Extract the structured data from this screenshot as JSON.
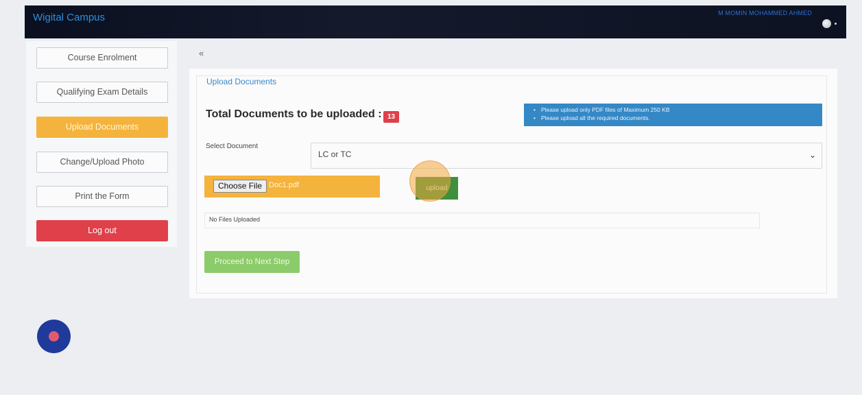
{
  "header": {
    "brand": "Wigital Campus",
    "user_name": "M MOMIN MOHAMMED AHMED"
  },
  "sidebar": {
    "items": [
      {
        "label": "Course Enrolment"
      },
      {
        "label": "Qualifying Exam Details"
      },
      {
        "label": "Upload Documents"
      },
      {
        "label": "Change/Upload Photo"
      },
      {
        "label": "Print the Form"
      },
      {
        "label": "Log out"
      }
    ]
  },
  "main": {
    "collapse_glyph": "«",
    "section_legend": "Upload Documents",
    "total_label": "Total Documents to be uploaded :",
    "total_count": "13",
    "info": [
      "Please upload only PDF files of Maximum 250 KB",
      "Please upload all the required documents."
    ],
    "select_label": "Select Document",
    "select_value": "LC or TC",
    "choose_file_label": "Choose File",
    "file_name": "Doc1.pdf",
    "upload_label": "upload",
    "files_status": "No Files Uploaded",
    "proceed_label": "Proceed to Next Step"
  },
  "colors": {
    "header_bg": "#0f1424",
    "accent_blue": "#3588c6",
    "active_orange": "#f4b33c",
    "danger_red": "#e0404a",
    "upload_green": "#3f8f3f",
    "proceed_green": "#8ccb6a",
    "fab_blue": "#1f3a9a"
  }
}
